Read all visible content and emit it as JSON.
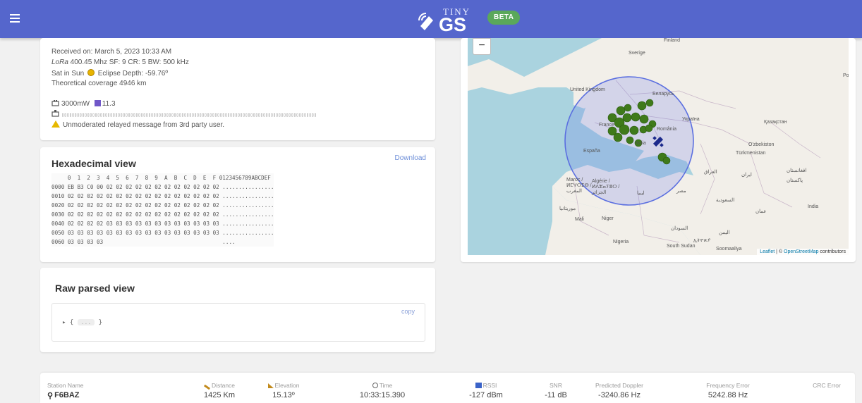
{
  "header": {
    "logo_tiny": "TINY",
    "logo_gs": "GS",
    "beta_badge": "BETA",
    "accent_color": "#5566cc"
  },
  "info": {
    "received": "Received on: March 5, 2023 10:33 AM",
    "lora_modulation": "LoRa",
    "lora_params": " 400.45 Mhz SF: 9 CR: 5 BW: 500 kHz",
    "sat_in_sun": "Sat in Sun",
    "eclipse": "Eclipse Depth: -59.76º",
    "coverage": "Theoretical coverage 4946 km",
    "power": "3000mW",
    "temp": "11.3",
    "payload_garbled": "▯▯▯▯▯▯▯▯▯▯▯▯▯▯▯▯▯▯▯▯▯▯▯▯▯▯▯▯▯▯▯▯▯▯▯▯▯▯▯▯▯▯▯▯▯▯▯▯▯▯▯▯▯▯▯▯▯▯▯▯▯▯▯▯▯▯▯▯▯▯▯▯▯▯▯▯▯▯▯▯▯▯▯▯▯▯▯▯▯▯▯▯▯▯▯▯▯▯▯▯",
    "warning": "Unmoderated relayed message from 3rd party user."
  },
  "hex": {
    "title": "Hexadecimal view",
    "download": "Download",
    "header_row": "     0  1  2  3  4  5  6  7  8  9  A  B  C  D  E  F 0123456789ABCDEF",
    "rows": [
      "0000 EB B3 C0 00 02 02 02 02 02 02 02 02 02 02 02 02 ................",
      "0010 02 02 02 02 02 02 02 02 02 02 02 02 02 02 02 02 ................",
      "0020 02 02 02 02 02 02 02 02 02 02 02 02 02 02 02 02 ................",
      "0030 02 02 02 02 02 02 02 02 02 02 02 02 02 02 02 02 ................",
      "0040 02 02 02 02 03 03 03 03 03 03 03 03 03 03 03 03 ................",
      "0050 03 03 03 03 03 03 03 03 03 03 03 03 03 03 03 03 ................",
      "0060 03 03 03 03                                     ...."
    ]
  },
  "raw": {
    "title": "Raw parsed view",
    "copy": "copy",
    "tree_open": "▸ {",
    "tree_ellipsis": "...",
    "tree_close": "}"
  },
  "map": {
    "zoom_out": "−",
    "attribution_leaflet": "Leaflet",
    "attribution_sep": " | © ",
    "attribution_osm": "OpenStreetMap",
    "attribution_tail": " contributors",
    "labels": {
      "sverige": "Sverige",
      "finland": "Finland",
      "uk": "United Kingdom",
      "belarus": "Беларусь",
      "ukraine": "Україна",
      "kazakhstan": "Қазақстан",
      "france": "France",
      "romania": "România",
      "italia": "Italia",
      "espana": "España",
      "uzbekistan": "O'zbekiston",
      "turkmenistan": "Türkmenistan",
      "iraq": "العراق",
      "iran": "ایران",
      "afghanistan": "افغانستان",
      "pakistan": "پاکستان",
      "maroc": "Maroc / ⵍⵎⵖⵔⵉⴱ / المغرب",
      "algerie": "Algérie / ⵍⴷⵣⴰⵢⴻⵔ / الجزائر",
      "libya": "ليبيا",
      "egypt": "مصر",
      "saudi": "السعودية",
      "oman": "عمان",
      "india": "India",
      "mauritania": "موريتانيا",
      "mali": "Mali",
      "niger": "Niger",
      "sudan": "السودان",
      "yemen": "اليمن",
      "nigeria": "Nigeria",
      "south_sudan": "South Sudan",
      "ethiopia": "ኢትዮጵያ",
      "somalia": "Soomaaliya",
      "po": "Po"
    }
  },
  "stats": {
    "station_label": "Station Name",
    "station_value": "F6BAZ",
    "distance_label": "Distance",
    "distance_value": "1425 Km",
    "elevation_label": "Elevation",
    "elevation_value": "15.13º",
    "time_label": "Time",
    "time_value": "10:33:15.390",
    "rssi_label": "RSSI",
    "rssi_value": "-127 dBm",
    "snr_label": "SNR",
    "snr_value": "-11 dB",
    "doppler_label": "Predicted Doppler",
    "doppler_value": "-3240.86 Hz",
    "freq_err_label": "Frequency Error",
    "freq_err_value": "5242.88 Hz",
    "crc_label": "CRC Error",
    "crc_value": ""
  }
}
